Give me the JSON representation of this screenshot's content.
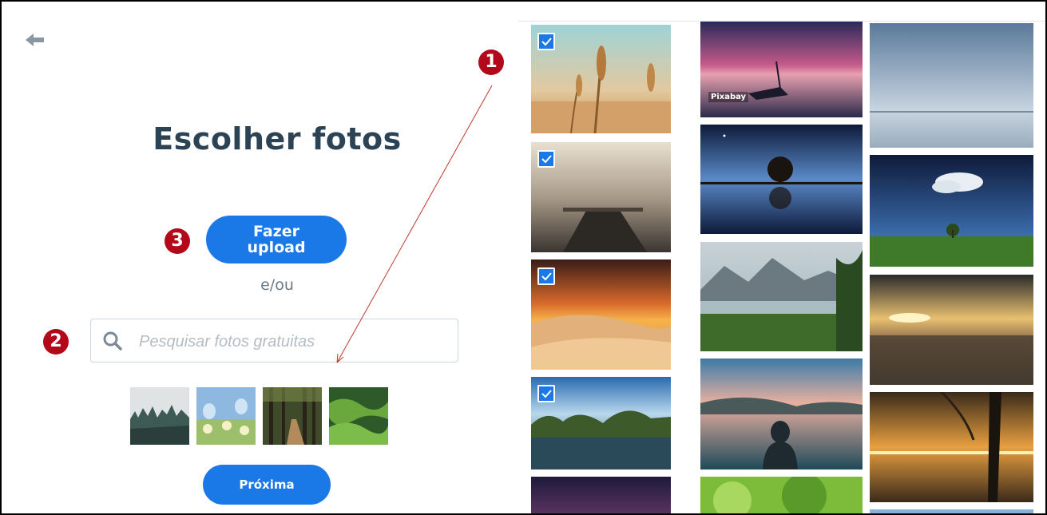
{
  "page": {
    "title": "Escolher fotos",
    "upload_label": "Fazer upload",
    "separator": "e/ou",
    "next_label": "Próxima"
  },
  "search": {
    "placeholder": "Pesquisar fotos gratuitas",
    "value": ""
  },
  "annotations": {
    "badge_1": "1",
    "badge_2": "2",
    "badge_3": "3",
    "badge_color": "#b3081a"
  },
  "suggested_searches": [
    {
      "icon": "misty-forest-photo"
    },
    {
      "icon": "butterflies-flowers-photo"
    },
    {
      "icon": "forest-path-photo"
    },
    {
      "icon": "green-hills-photo"
    }
  ],
  "gallery": {
    "columns": [
      [
        {
          "subject": "wheat-field",
          "selected": true
        },
        {
          "subject": "misty-pier",
          "selected": true
        },
        {
          "subject": "desert-sunset",
          "selected": true
        },
        {
          "subject": "lake-landscape",
          "selected": true
        },
        {
          "subject": "purple-sky",
          "selected": false
        }
      ],
      [
        {
          "subject": "boat-at-dusk",
          "selected": false,
          "source": "Pixabay"
        },
        {
          "subject": "lone-tree-reflection",
          "selected": false
        },
        {
          "subject": "mountain-lake-grass",
          "selected": false
        },
        {
          "subject": "person-at-lake",
          "selected": false
        },
        {
          "subject": "green-foliage",
          "selected": false
        }
      ],
      [
        {
          "subject": "calm-sea-horizon",
          "selected": false
        },
        {
          "subject": "cloud-over-tree",
          "selected": false
        },
        {
          "subject": "beach-sunset",
          "selected": false
        },
        {
          "subject": "palm-sunset",
          "selected": false
        },
        {
          "subject": "blue-sky",
          "selected": false
        }
      ]
    ]
  },
  "colors": {
    "accent": "#1a79e6",
    "title": "#2c4356",
    "muted": "#6b7a87"
  }
}
